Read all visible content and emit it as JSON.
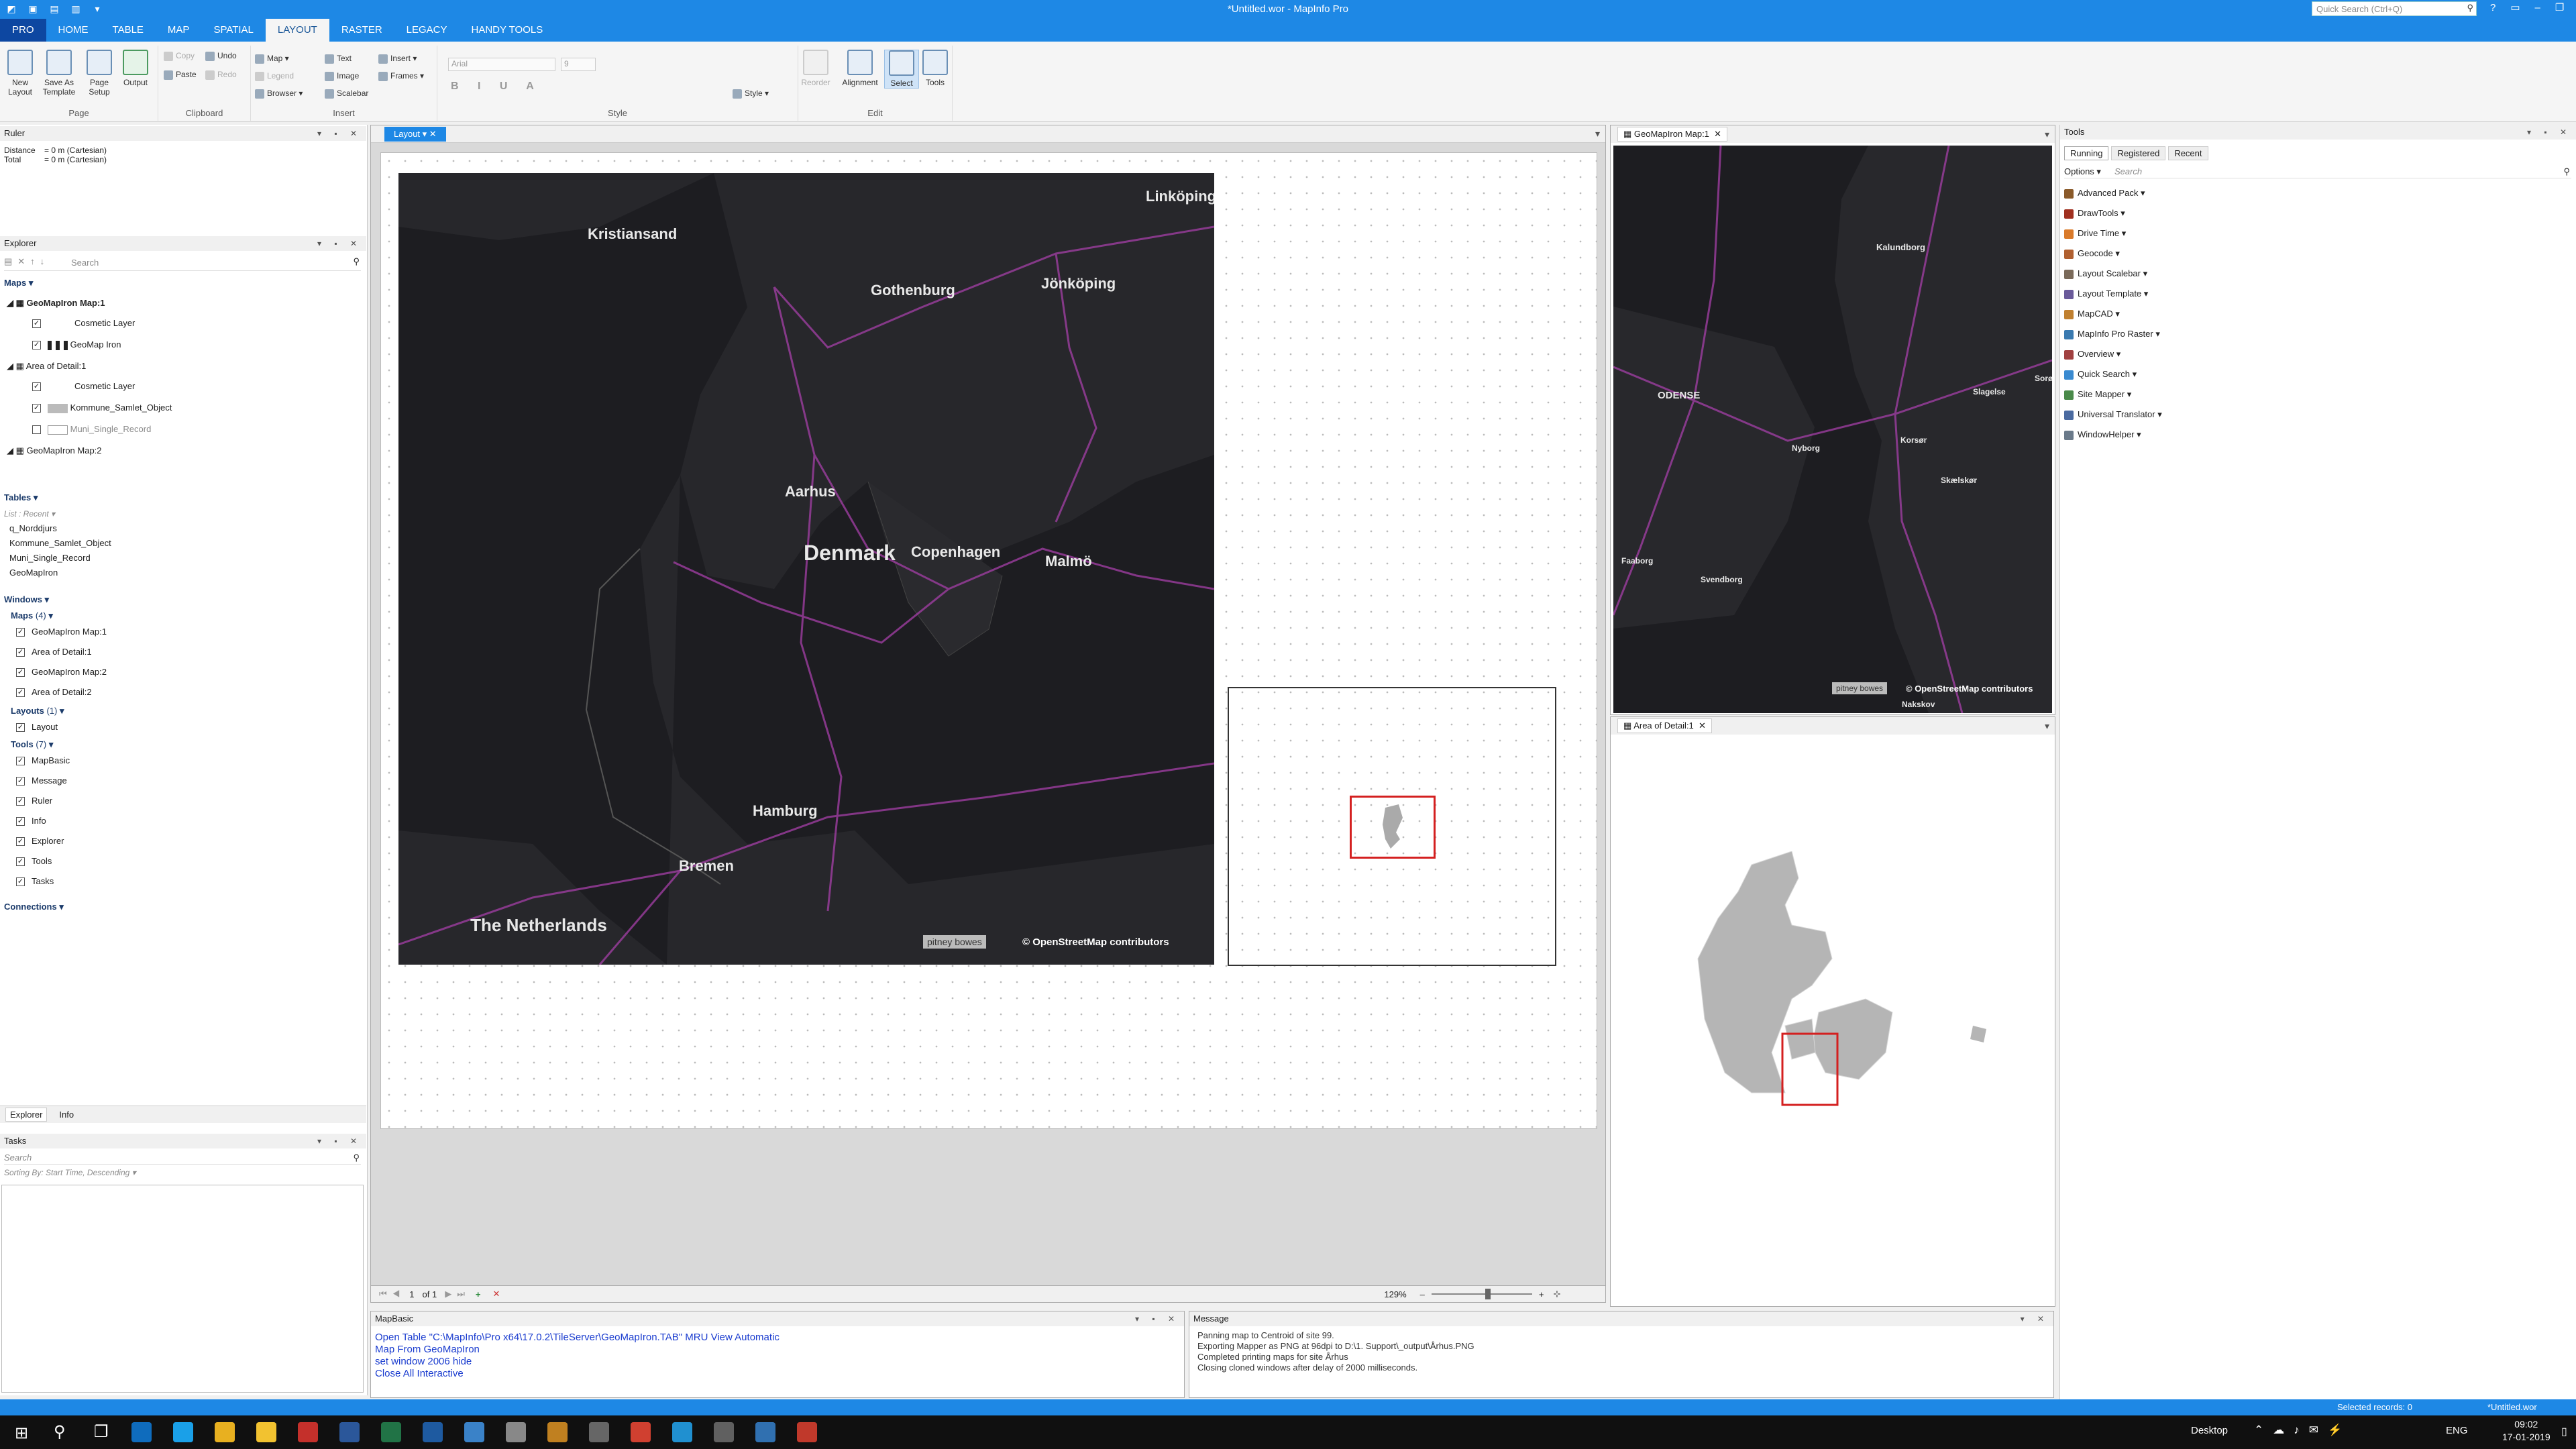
{
  "window": {
    "title": "*Untitled.wor - MapInfo Pro",
    "quick_search_placeholder": "Quick Search (Ctrl+Q)"
  },
  "ribbon": {
    "tabs": [
      "PRO",
      "HOME",
      "TABLE",
      "MAP",
      "SPATIAL",
      "LAYOUT",
      "RASTER",
      "LEGACY",
      "HANDY TOOLS"
    ],
    "active_tab": "LAYOUT",
    "page_group": {
      "label": "Page",
      "buttons": [
        "New Layout",
        "Save As Template",
        "Page Setup",
        "Output"
      ]
    },
    "clipboard_group": {
      "label": "Clipboard",
      "copy": "Copy",
      "paste": "Paste",
      "undo": "Undo",
      "redo": "Redo"
    },
    "insert_group": {
      "label": "Insert",
      "map": "Map",
      "legend": "Legend",
      "browser": "Browser",
      "text": "Text",
      "image": "Image",
      "scalebar": "Scalebar",
      "insert": "Insert",
      "frames": "Frames"
    },
    "style_group": {
      "label": "Style",
      "font": "Arial",
      "size": "9",
      "style": "Style"
    },
    "edit_group": {
      "label": "Edit",
      "reorder": "Reorder",
      "alignment": "Alignment",
      "select": "Select",
      "tools": "Tools"
    }
  },
  "ruler": {
    "title": "Ruler",
    "distance_label": "Distance",
    "distance_value": "= 0 m (Cartesian)",
    "total_label": "Total",
    "total_value": "= 0 m (Cartesian)"
  },
  "explorer": {
    "title": "Explorer",
    "search_placeholder": "Search",
    "maps_header": "Maps",
    "map1": {
      "name": "GeoMapIron Map:1",
      "layers": [
        "Cosmetic Layer",
        "GeoMap Iron"
      ]
    },
    "map2": {
      "name": "Area of Detail:1",
      "layers": [
        "Cosmetic Layer",
        "Kommune_Samlet_Object",
        "Muni_Single_Record"
      ]
    },
    "map3": {
      "name": "GeoMapIron Map:2"
    },
    "tables_header": "Tables",
    "tables_list_label": "List : Recent",
    "tables": [
      "q_Norddjurs",
      "Kommune_Samlet_Object",
      "Muni_Single_Record",
      "GeoMapIron"
    ],
    "windows_header": "Windows",
    "windows_maps_label": "Maps",
    "windows_maps_count": "(4)",
    "windows_maps": [
      "GeoMapIron Map:1",
      "Area of Detail:1",
      "GeoMapIron Map:2",
      "Area of Detail:2"
    ],
    "layouts_label": "Layouts",
    "layouts_count": "(1)",
    "layouts": [
      "Layout"
    ],
    "tools_label": "Tools",
    "tools_count": "(7)",
    "tools": [
      "MapBasic",
      "Message",
      "Ruler",
      "Info",
      "Explorer",
      "Tools",
      "Tasks"
    ],
    "connections_header": "Connections",
    "bottom_tabs": [
      "Explorer",
      "Info"
    ]
  },
  "tasks": {
    "title": "Tasks",
    "search_placeholder": "Search",
    "sorting": "Sorting By: Start Time, Descending"
  },
  "layout_window": {
    "tab": "Layout",
    "map_labels": [
      "Kristiansand",
      "Linköping",
      "Gothenburg",
      "Jönköping",
      "Aarhus",
      "Denmark",
      "Copenhagen",
      "Malmö",
      "Hamburg",
      "Bremen",
      "The Netherlands"
    ],
    "attribution": "© OpenStreetMap contributors",
    "pb_logo": "pitney bowes",
    "page_current": "1",
    "page_of": "of 1",
    "zoom": "129%"
  },
  "geomap_window": {
    "tab": "GeoMapIron Map:1",
    "labels": [
      "Kalundborg",
      "ODENSE",
      "Slagelse",
      "Sorø",
      "Nyborg",
      "Korsør",
      "Skælskør",
      "Faaborg",
      "Svendborg",
      "Nakskov"
    ],
    "attribution": "© OpenStreetMap contributors",
    "pb_logo": "pitney bowes"
  },
  "aod_window": {
    "tab": "Area of Detail:1"
  },
  "tools_panel": {
    "title": "Tools",
    "tabs": [
      "Running",
      "Registered",
      "Recent"
    ],
    "options": "Options",
    "search_placeholder": "Search",
    "items": [
      "Advanced Pack",
      "DrawTools",
      "Drive Time",
      "Geocode",
      "Layout Scalebar",
      "Layout Template",
      "MapCAD",
      "MapInfo Pro Raster",
      "Overview",
      "Quick Search",
      "Site Mapper",
      "Universal Translator",
      "WindowHelper"
    ]
  },
  "mapbasic": {
    "title": "MapBasic",
    "lines": [
      "Open Table \"C:\\MapInfo\\Pro x64\\17.0.2\\TileServer\\GeoMapIron.TAB\" MRU View Automatic",
      "Map From GeoMapIron",
      "set window 2006 hide",
      "Close All Interactive"
    ]
  },
  "message": {
    "title": "Message",
    "lines": [
      "Panning map to Centroid of site 99.",
      "Exporting Mapper as PNG at 96dpi to D:\\1. Support\\_output\\Århus.PNG",
      "Completed printing maps for site Århus",
      "Closing cloned windows after delay of 2000 milliseconds."
    ]
  },
  "statusbar": {
    "selected": "Selected records: 0",
    "workspace": "*Untitled.wor"
  },
  "taskbar": {
    "desktop": "Desktop",
    "lang": "ENG",
    "time": "09:02",
    "date": "17-01-2019"
  },
  "colors": {
    "accent": "#1e88e5",
    "map_dark": "#1d1d21",
    "road": "#a53fa8",
    "highlight": "#d42020"
  }
}
